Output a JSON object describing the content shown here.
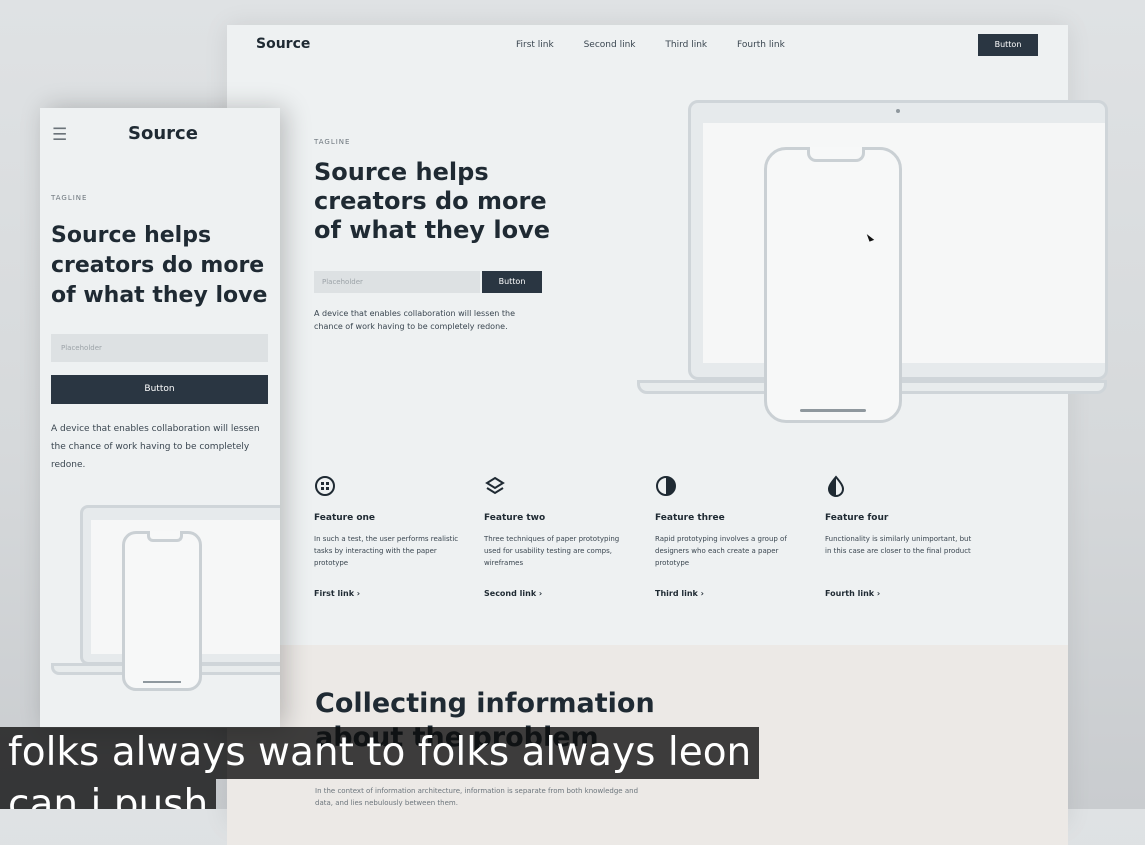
{
  "desktop": {
    "nav": {
      "logo": "Source",
      "links": [
        "First link",
        "Second link",
        "Third link",
        "Fourth link"
      ],
      "button": "Button"
    },
    "hero": {
      "tagline": "TAGLINE",
      "headline": "Source helps creators do more of what they love",
      "input_placeholder": "Placeholder",
      "button": "Button",
      "description": "A device that enables collaboration will lessen the chance of work having to be completely redone."
    },
    "features": [
      {
        "icon": "grid-circle-icon",
        "title": "Feature one",
        "description": "In such a test, the user performs realistic tasks by interacting with the paper prototype",
        "link": "First link ›"
      },
      {
        "icon": "layers-icon",
        "title": "Feature two",
        "description": "Three techniques of paper prototyping used for usability testing are comps, wireframes",
        "link": "Second link ›"
      },
      {
        "icon": "half-circle-icon",
        "title": "Feature three",
        "description": "Rapid prototyping involves a group of designers who each create a paper prototype",
        "link": "Third link ›"
      },
      {
        "icon": "drop-half-icon",
        "title": "Feature four",
        "description": "Functionality is similarly unimportant, but in this case are closer to the final product",
        "link": "Fourth link ›"
      }
    ],
    "section": {
      "title": "Collecting information about the problem",
      "subtitle": "In the context of information architecture, information is separate from both knowledge and data, and lies nebulously between them."
    }
  },
  "mobile": {
    "logo": "Source",
    "menu_icon": "hamburger-menu-icon",
    "tagline": "TAGLINE",
    "headline": "Source helps creators do more of what they love",
    "input_placeholder": "Placeholder",
    "button": "Button",
    "description": "A device that enables collaboration will lessen the chance of work having to be completely redone."
  },
  "captions": {
    "line1": "folks always want to folks always leon",
    "line2": "can i push"
  },
  "colors": {
    "dark_button": "#2a3642",
    "page_bg": "#eef1f2",
    "caption_bg": "#0c0c0c"
  }
}
